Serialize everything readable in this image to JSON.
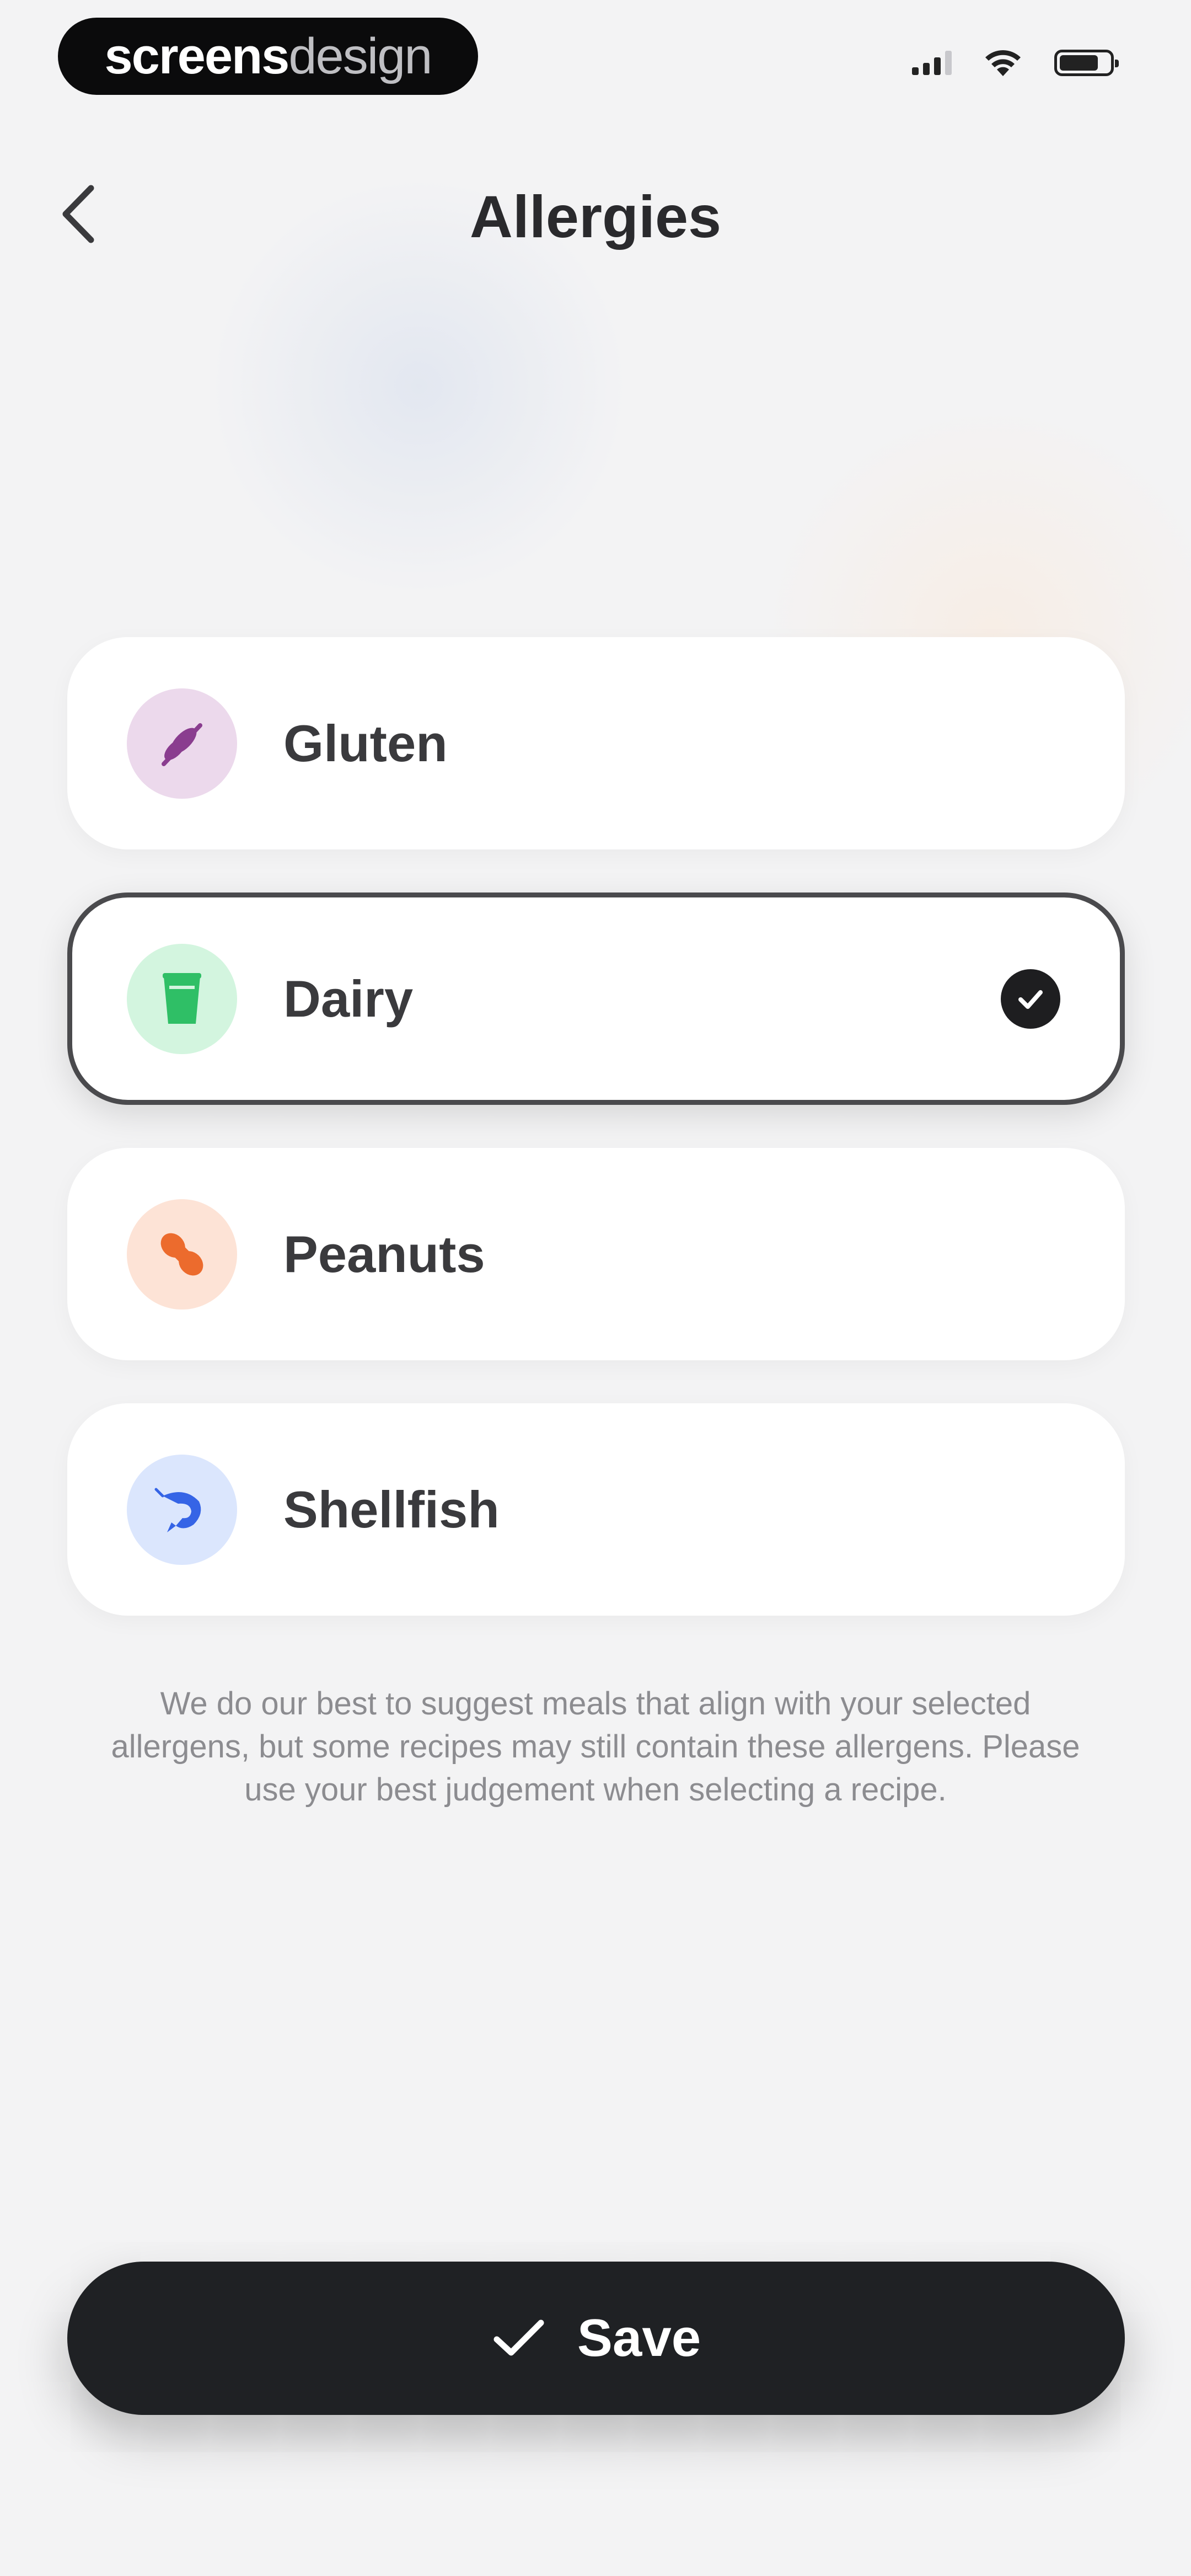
{
  "status_bar": {
    "brand_bold": "screens",
    "brand_light": "design",
    "icons": [
      "signal-icon",
      "wifi-icon",
      "battery-icon"
    ]
  },
  "header": {
    "title": "Allergies",
    "back_icon": "chevron-left-icon"
  },
  "allergies": [
    {
      "label": "Gluten",
      "icon": "wheat-icon",
      "tint": "#ecd9ec",
      "icon_color": "#8a3d8f",
      "selected": false
    },
    {
      "label": "Dairy",
      "icon": "milk-glass-icon",
      "tint": "#d3f5df",
      "icon_color": "#2fbf66",
      "selected": true
    },
    {
      "label": "Peanuts",
      "icon": "peanut-icon",
      "tint": "#fde3d6",
      "icon_color": "#ec6b2d",
      "selected": false
    },
    {
      "label": "Shellfish",
      "icon": "shrimp-icon",
      "tint": "#dbe6fd",
      "icon_color": "#3564e6",
      "selected": false
    }
  ],
  "disclaimer": "We do our best to suggest meals that align with your selected allergens, but some recipes may still contain these allergens. Please use your best judgement when selecting a recipe.",
  "save_button": {
    "label": "Save",
    "icon": "checkmark-icon"
  },
  "colors": {
    "background": "#f3f3f4",
    "card": "#ffffff",
    "selected_border": "#4a4a4d",
    "button": "#1f2124"
  }
}
